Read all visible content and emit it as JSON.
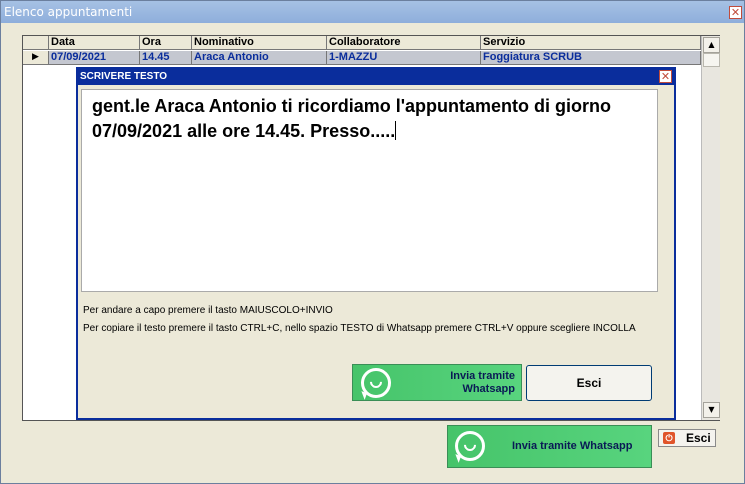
{
  "window": {
    "title": "Elenco appuntamenti",
    "close_glyph": "✕"
  },
  "grid": {
    "columns": [
      "Data",
      "Ora",
      "Nominativo",
      "Collaboratore",
      "Servizio"
    ],
    "row": {
      "indicator": "▶",
      "cells": [
        "07/09/2021",
        "14.45",
        "Araca Antonio",
        "1-MAZZU",
        "Foggiatura SCRUB"
      ]
    },
    "scroll_up": "▲",
    "scroll_down": "▼"
  },
  "dialog": {
    "title": "SCRIVERE TESTO",
    "close_glyph": "✕",
    "text_line1": "gent.le Araca Antonio ti ricordiamo l'appuntamento di giorno",
    "text_line2": "07/09/2021 alle ore 14.45. Presso.....",
    "hint1": "Per andare a capo premere il tasto MAIUSCOLO+INVIO",
    "hint2": "Per copiare il testo premere il tasto CTRL+C, nello spazio TESTO di Whatsapp premere CTRL+V oppure scegliere INCOLLA",
    "whatsapp_line1": "Invia tramite",
    "whatsapp_line2": "Whatsapp",
    "esci": "Esci"
  },
  "footer": {
    "whatsapp": "Invia tramite Whatsapp",
    "esci": "Esci"
  },
  "icons": {
    "whatsapp": "whatsapp-icon",
    "exit": "exit-icon"
  },
  "colors": {
    "whatsapp_green": "#4cc970",
    "dialog_blue": "#0a2d9c",
    "row_text": "#0a2d9c"
  }
}
